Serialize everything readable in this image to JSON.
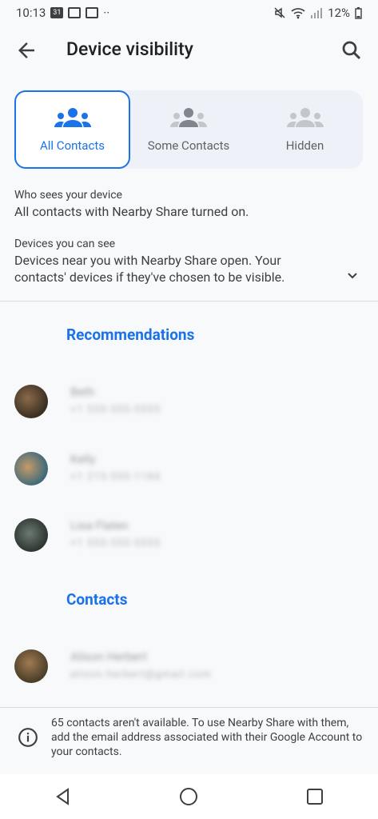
{
  "status": {
    "time": "10:13",
    "calendar_day": "31",
    "battery": "12%"
  },
  "appbar": {
    "title": "Device visibility"
  },
  "segments": [
    {
      "label": "All Contacts",
      "selected": true
    },
    {
      "label": "Some Contacts",
      "selected": false
    },
    {
      "label": "Hidden",
      "selected": false
    }
  ],
  "who_sees": {
    "heading": "Who sees your device",
    "body": "All contacts with Nearby Share turned on."
  },
  "devices_see": {
    "heading": "Devices you can see",
    "body": "Devices near you with Nearby Share open. Your contacts' devices if they've chosen to be visible."
  },
  "recommendations": {
    "title": "Recommendations",
    "items": [
      {
        "name": "Beth",
        "detail": "+1 555-555-5555"
      },
      {
        "name": "Kelly",
        "detail": "+1 215-555-1184"
      },
      {
        "name": "Lisa Flaten",
        "detail": "+1 555-555-5555"
      }
    ]
  },
  "contacts": {
    "title": "Contacts",
    "items": [
      {
        "name": "Alison Herbert",
        "detail": "alison.herbert@gmail.com"
      }
    ]
  },
  "footer": {
    "text": "65 contacts aren't available. To use Nearby Share with them, add the email address associated with their Google Account to your contacts."
  },
  "colors": {
    "accent": "#1a73e8",
    "text": "#202124",
    "secondary": "#5f6368",
    "background": "#f8f9fa"
  }
}
